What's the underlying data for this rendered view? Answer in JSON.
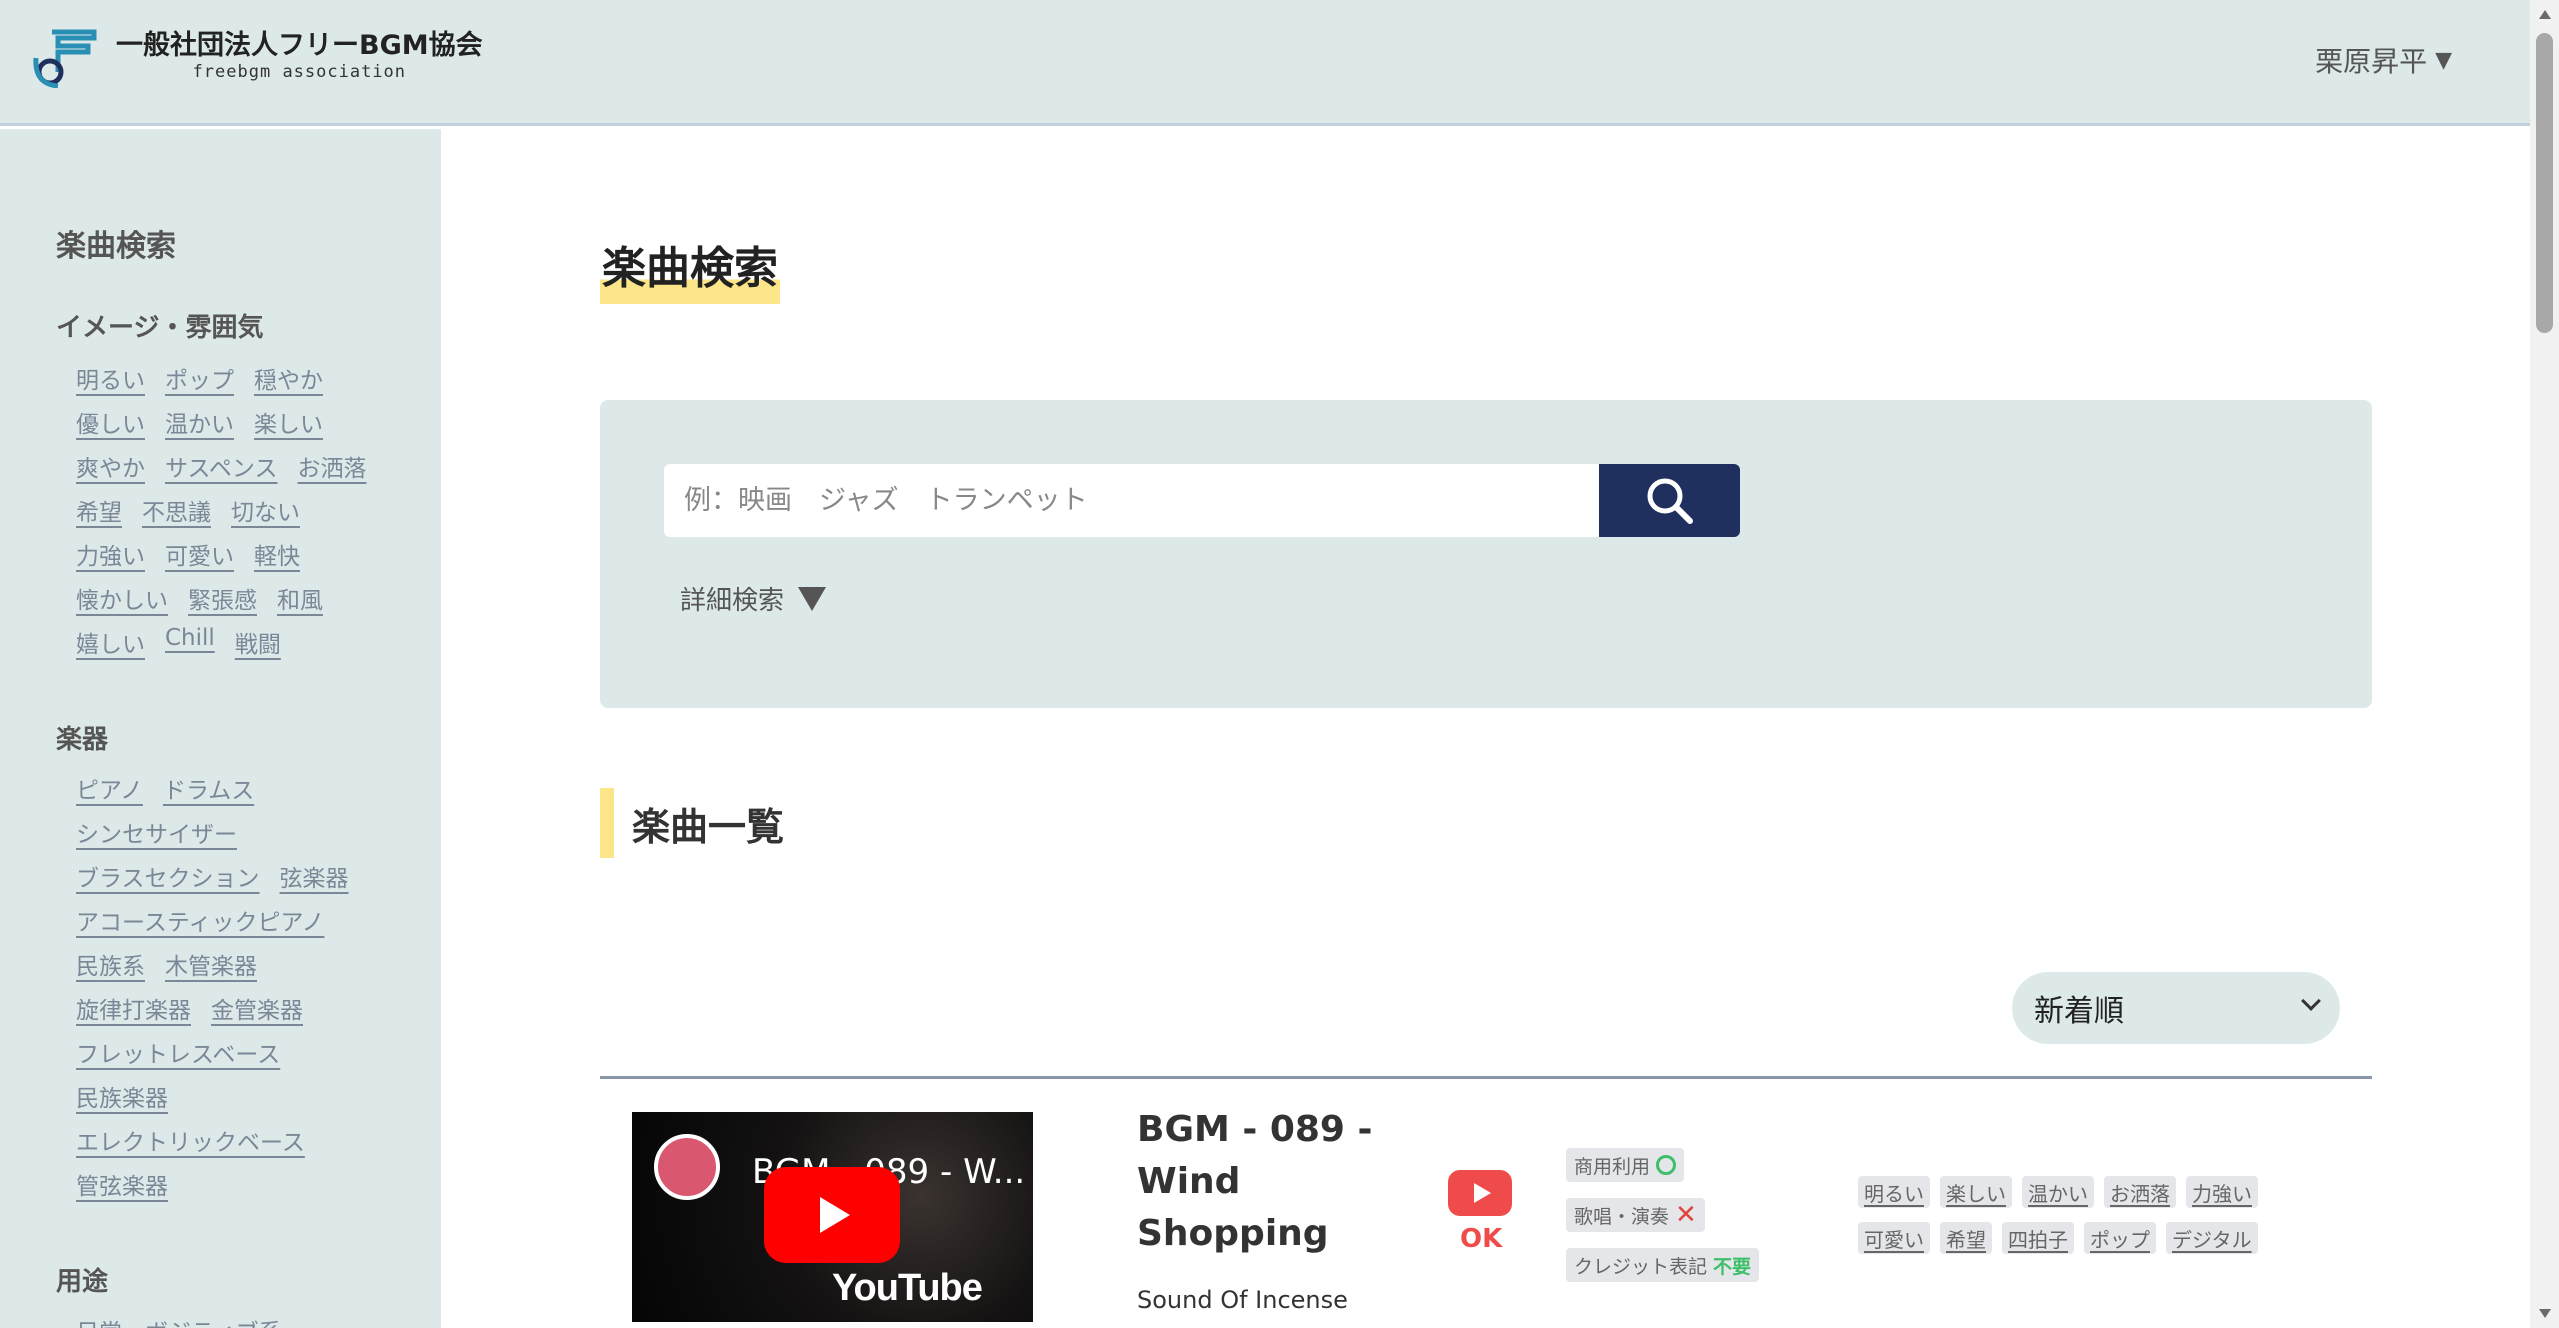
{
  "header": {
    "logo_title": "一般社団法人フリーBGM協会",
    "logo_subtitle": "freebgm association",
    "user_name": "栗原昇平"
  },
  "sidebar": {
    "title": "楽曲検索",
    "groups": [
      {
        "title": "イメージ・雰囲気",
        "rows": [
          [
            "明るい",
            "ポップ",
            "穏やか"
          ],
          [
            "優しい",
            "温かい",
            "楽しい"
          ],
          [
            "爽やか",
            "サスペンス",
            "お洒落"
          ],
          [
            "希望",
            "不思議",
            "切ない"
          ],
          [
            "力強い",
            "可愛い",
            "軽快"
          ],
          [
            "懐かしい",
            "緊張感",
            "和風"
          ],
          [
            "嬉しい",
            "Chill",
            "戦闘"
          ]
        ]
      },
      {
        "title": "楽器",
        "rows": [
          [
            "ピアノ",
            "ドラムス"
          ],
          [
            "シンセサイザー"
          ],
          [
            "ブラスセクション",
            "弦楽器"
          ],
          [
            "アコースティックピアノ"
          ],
          [
            "民族系",
            "木管楽器"
          ],
          [
            "旋律打楽器",
            "金管楽器"
          ],
          [
            "フレットレスベース"
          ],
          [
            "民族楽器"
          ],
          [
            "エレクトリックベース"
          ],
          [
            "管弦楽器"
          ]
        ]
      },
      {
        "title": "用途",
        "rows": [
          [
            "日常・ボジティブ系"
          ]
        ]
      }
    ]
  },
  "main": {
    "title": "楽曲検索",
    "search": {
      "placeholder": "例：映画　ジャズ　トランペット",
      "value": "",
      "detail_label": "詳細検索"
    },
    "list_heading": "楽曲一覧",
    "sort": {
      "selected": "新着順"
    }
  },
  "songs": [
    {
      "title": "BGM - 089 - Wind Shopping",
      "artist": "Sound Of Incense",
      "thumbnail_text": "BGM - 089 - W...",
      "youtube_wordmark": "YouTube",
      "youtube_status": "OK",
      "licenses": {
        "commercial_label": "商用利用",
        "singing_label": "歌唱・演奏",
        "credit_label": "クレジット表記",
        "credit_value": "不要"
      },
      "tags": [
        [
          "明るい",
          "楽しい",
          "温かい",
          "お洒落",
          "力強い"
        ],
        [
          "可愛い",
          "希望",
          "四拍子",
          "ポップ",
          "デジタル"
        ]
      ]
    }
  ],
  "colors": {
    "panel_bg": "#dde9e9",
    "search_button": "#1f2f5e",
    "accent_yellow": "#fde58a",
    "youtube_red": "#f04b4b",
    "ok_green": "#3fbf6a",
    "ng_red": "#e0443c"
  },
  "icons": {
    "search": "magnifier-icon",
    "logo": "music-note-logo-icon"
  }
}
